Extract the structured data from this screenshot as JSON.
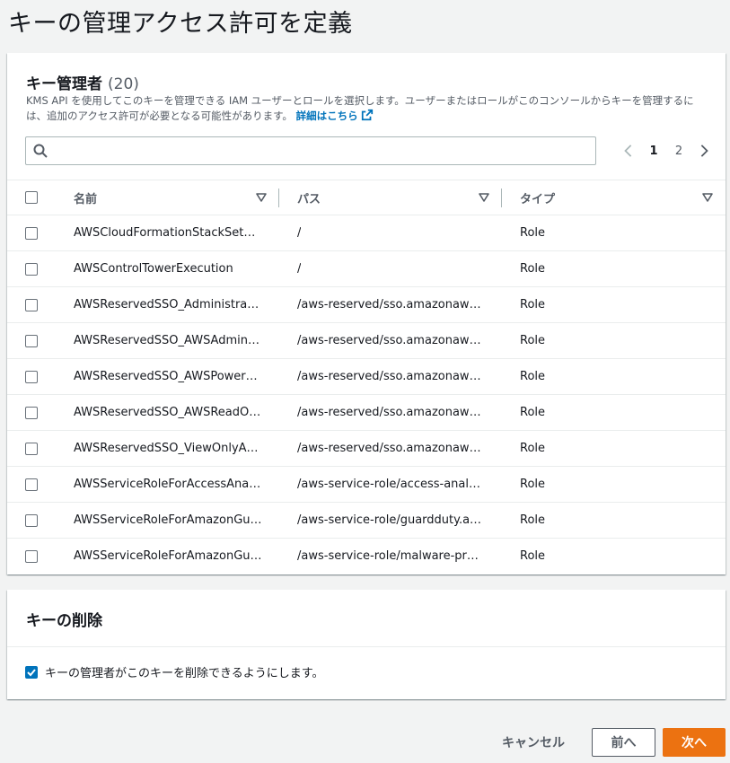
{
  "page": {
    "title": "キーの管理アクセス許可を定義"
  },
  "admins": {
    "title": "キー管理者",
    "count": "(20)",
    "description": "KMS API を使用してこのキーを管理できる IAM ユーザーとロールを選択します。ユーザーまたはロールがこのコンソールからキーを管理するには、追加のアクセス許可が必要となる可能性があります。",
    "learn_more": "詳細はこちら",
    "search": {
      "placeholder": "",
      "value": ""
    },
    "pagination": {
      "pages": [
        "1",
        "2"
      ],
      "current": "1"
    },
    "columns": {
      "name": "名前",
      "path": "パス",
      "type": "タイプ"
    },
    "rows": [
      {
        "name": "AWSCloudFormationStackSet…",
        "path": "/",
        "type": "Role"
      },
      {
        "name": "AWSControlTowerExecution",
        "path": "/",
        "type": "Role"
      },
      {
        "name": "AWSReservedSSO_Administra…",
        "path": "/aws-reserved/sso.amazonaws…",
        "type": "Role"
      },
      {
        "name": "AWSReservedSSO_AWSAdmin…",
        "path": "/aws-reserved/sso.amazonaws…",
        "type": "Role"
      },
      {
        "name": "AWSReservedSSO_AWSPower…",
        "path": "/aws-reserved/sso.amazonaws…",
        "type": "Role"
      },
      {
        "name": "AWSReservedSSO_AWSReadO…",
        "path": "/aws-reserved/sso.amazonaws…",
        "type": "Role"
      },
      {
        "name": "AWSReservedSSO_ViewOnlyA…",
        "path": "/aws-reserved/sso.amazonaws…",
        "type": "Role"
      },
      {
        "name": "AWSServiceRoleForAccessAnal…",
        "path": "/aws-service-role/access-analy…",
        "type": "Role"
      },
      {
        "name": "AWSServiceRoleForAmazonGu…",
        "path": "/aws-service-role/guardduty.a…",
        "type": "Role"
      },
      {
        "name": "AWSServiceRoleForAmazonGu…",
        "path": "/aws-service-role/malware-pr…",
        "type": "Role"
      }
    ]
  },
  "deletion": {
    "title": "キーの削除",
    "checkbox_label": "キーの管理者がこのキーを削除できるようにします。",
    "checked": true
  },
  "footer": {
    "cancel": "キャンセル",
    "previous": "前へ",
    "next": "次へ"
  },
  "colors": {
    "primary": "#ec7211",
    "link": "#0073bb",
    "checkbox": "#0073bb"
  },
  "icons": {
    "search": "search-icon",
    "external": "external-link-icon",
    "prev": "chevron-left-icon",
    "next": "chevron-right-icon",
    "sort": "caret-down-icon"
  }
}
